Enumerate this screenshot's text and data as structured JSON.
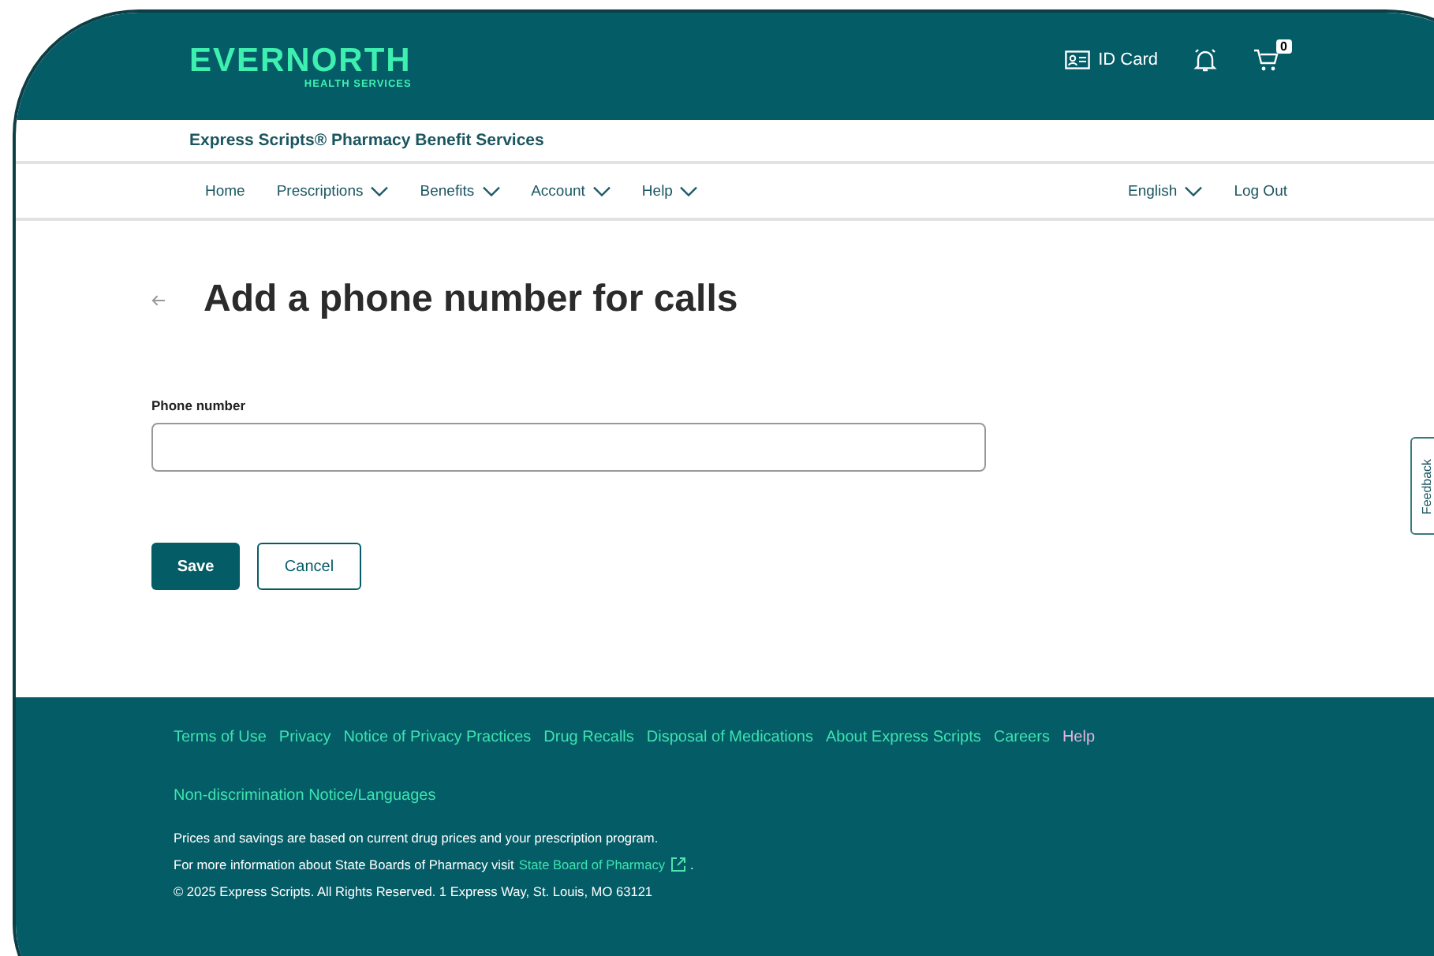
{
  "header": {
    "logo": "EVERNORTH",
    "logo_sub": "HEALTH SERVICES",
    "id_card": "ID Card",
    "cart_count": "0"
  },
  "subheader": {
    "title": "Express Scripts® Pharmacy Benefit Services"
  },
  "nav": {
    "items": [
      {
        "label": "Home",
        "dropdown": false
      },
      {
        "label": "Prescriptions",
        "dropdown": true
      },
      {
        "label": "Benefits",
        "dropdown": true
      },
      {
        "label": "Account",
        "dropdown": true
      },
      {
        "label": "Help",
        "dropdown": true
      }
    ],
    "right": [
      {
        "label": "English",
        "dropdown": true
      },
      {
        "label": "Log Out",
        "dropdown": false
      }
    ]
  },
  "page": {
    "title": "Add a phone number for calls",
    "field_label": "Phone number",
    "save": "Save",
    "cancel": "Cancel"
  },
  "feedback": "Feedback",
  "footer": {
    "links": [
      {
        "label": "Terms of Use",
        "visited": false
      },
      {
        "label": "Privacy",
        "visited": false
      },
      {
        "label": "Notice of Privacy Practices",
        "visited": false
      },
      {
        "label": "Drug Recalls",
        "visited": false
      },
      {
        "label": "Disposal of Medications",
        "visited": false
      },
      {
        "label": "About Express Scripts",
        "visited": false
      },
      {
        "label": "Careers",
        "visited": false
      },
      {
        "label": "Help",
        "visited": true
      }
    ],
    "notice": "Non-discrimination Notice/Languages",
    "prices": "Prices and savings are based on current drug prices and your prescription program.",
    "more_info": "For more information about State Boards of Pharmacy visit",
    "board_link": "State Board of Pharmacy",
    "period": ".",
    "copyright": "© 2025 Express Scripts. All Rights Reserved. 1 Express Way, St. Louis, MO 63121"
  }
}
